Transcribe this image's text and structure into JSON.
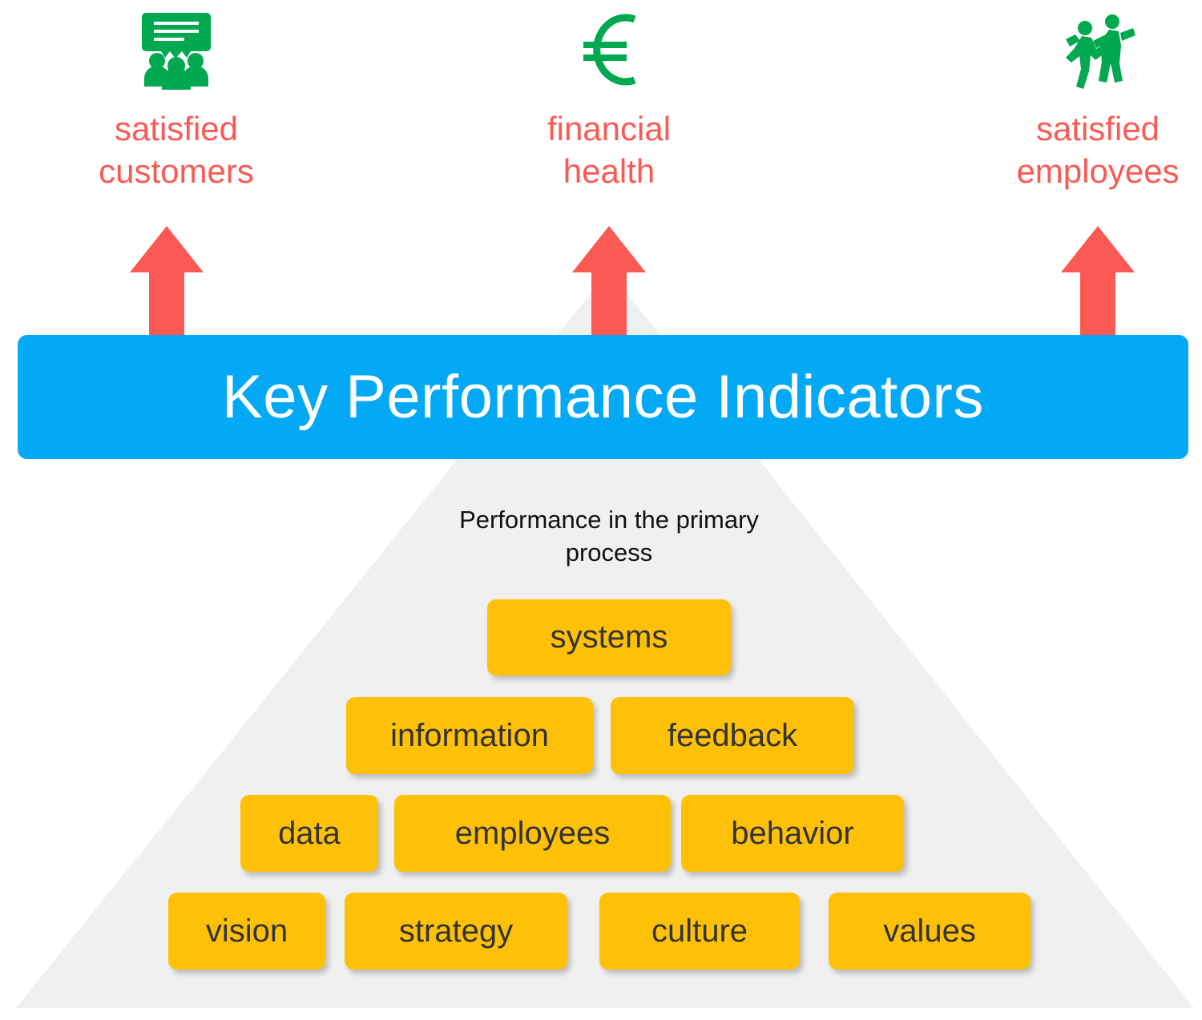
{
  "colors": {
    "accent_blue": "#03A9F4",
    "arrow_red": "#FB5A54",
    "label_red": "#FB5A54",
    "icon_green": "#00A94F",
    "block_yellow": "#FFC107",
    "block_text": "#333333",
    "pyramid_gray": "#F0F0F0",
    "banner_text": "#FFFFFF",
    "caption_text": "#111111"
  },
  "outcomes": [
    {
      "icon": "presentation-audience-icon",
      "label": "satisfied\ncustomers"
    },
    {
      "icon": "euro-currency-icon",
      "label": "financial\nhealth"
    },
    {
      "icon": "dancing-people-icon",
      "label": "satisfied\nemployees"
    }
  ],
  "arrows": [
    {
      "icon": "up-arrow-icon",
      "points_to": "satisfied customers"
    },
    {
      "icon": "up-arrow-icon",
      "points_to": "financial health"
    },
    {
      "icon": "up-arrow-icon",
      "points_to": "satisfied employees"
    }
  ],
  "banner": {
    "title": "Key Performance Indicators"
  },
  "pyramid": {
    "caption": "Performance in the primary\nprocess",
    "rows": [
      {
        "level": 1,
        "blocks": [
          {
            "label": "systems"
          }
        ]
      },
      {
        "level": 2,
        "blocks": [
          {
            "label": "information"
          },
          {
            "label": "feedback"
          }
        ]
      },
      {
        "level": 3,
        "blocks": [
          {
            "label": "data"
          },
          {
            "label": "employees"
          },
          {
            "label": "behavior"
          }
        ]
      },
      {
        "level": 4,
        "blocks": [
          {
            "label": "vision"
          },
          {
            "label": "strategy"
          },
          {
            "label": "culture"
          },
          {
            "label": "values"
          }
        ]
      }
    ]
  }
}
